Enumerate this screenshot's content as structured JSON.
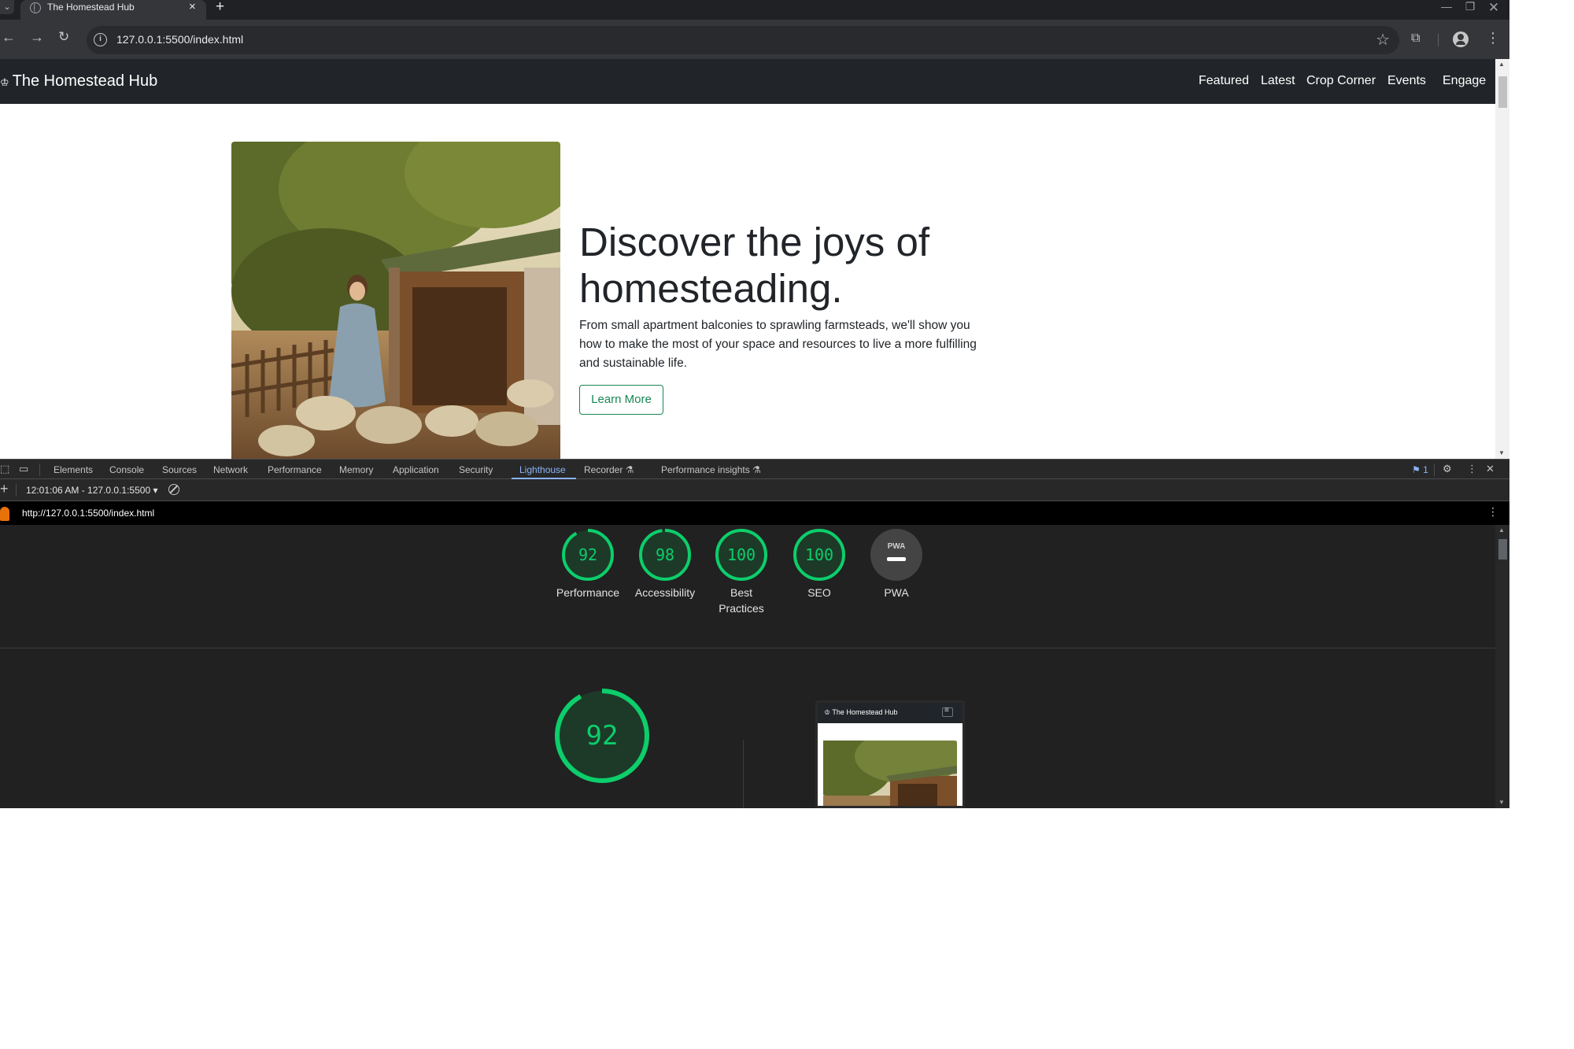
{
  "browser": {
    "tab_title": "The Homestead Hub",
    "tab_close": "×",
    "new_tab": "+",
    "url": "127.0.0.1:5500/index.html"
  },
  "site": {
    "brand": "The Homestead Hub",
    "nav": [
      "Featured",
      "Latest",
      "Crop Corner",
      "Events",
      "Engage"
    ],
    "hero_title": "Discover the joys of homesteading.",
    "hero_text": "From small apartment balconies to sprawling farmsteads, we'll show you how to make the most of your space and resources to live a more fulfilling and sustainable life.",
    "cta_label": "Learn More"
  },
  "devtools": {
    "tabs": [
      "Elements",
      "Console",
      "Sources",
      "Network",
      "Performance",
      "Memory",
      "Application",
      "Security",
      "Lighthouse",
      "Recorder",
      "Performance insights"
    ],
    "active_tab": "Lighthouse",
    "issues_count": "1",
    "report_selector": "12:01:06 AM - 127.0.0.1:5500",
    "lighthouse_url": "http://127.0.0.1:5500/index.html"
  },
  "lighthouse": {
    "scores": [
      {
        "label": "Performance",
        "score": 92
      },
      {
        "label": "Accessibility",
        "score": 98
      },
      {
        "label": "Best Practices",
        "score": 100
      },
      {
        "label": "SEO",
        "score": 100
      }
    ],
    "pwa": {
      "label": "PWA",
      "badge": "PWA"
    },
    "main_score": 92,
    "preview_brand": "The Homestead Hub"
  },
  "colors": {
    "pass_green": "#0cce6b",
    "accent_blue": "#8ab4f8",
    "bootstrap_success": "#198754"
  }
}
